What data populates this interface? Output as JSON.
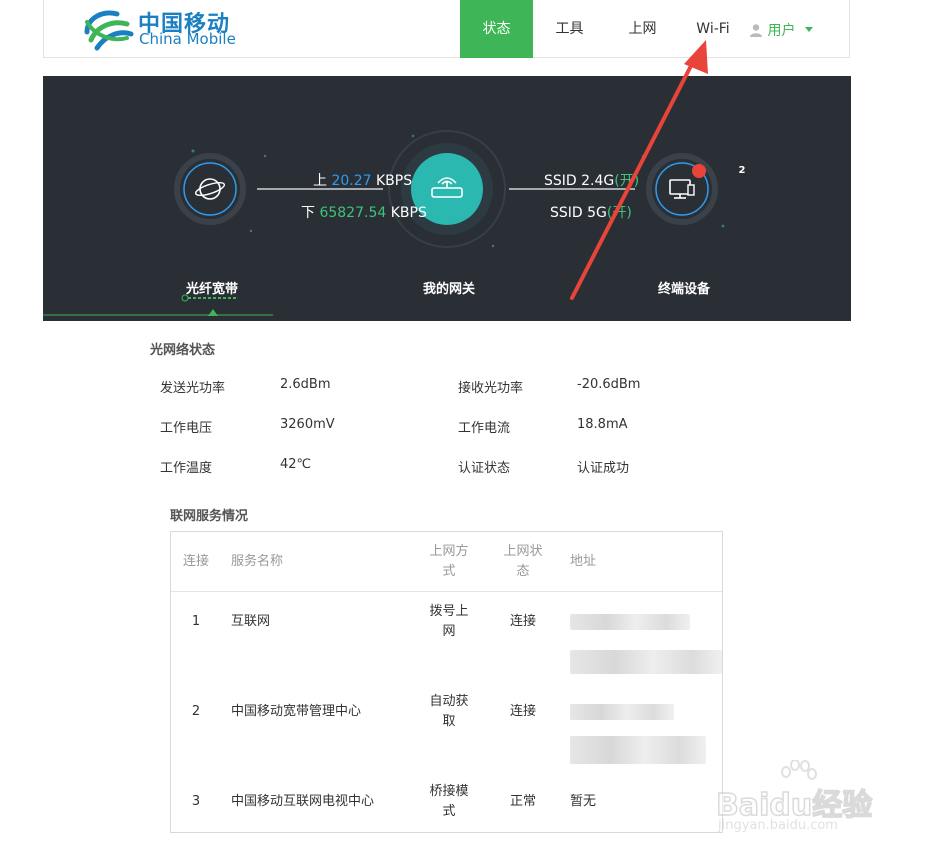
{
  "brand": {
    "name_cn": "中国移动",
    "name_en": "China Mobile"
  },
  "nav": {
    "items": [
      "状态",
      "工具",
      "上网",
      "Wi-Fi"
    ],
    "user_label": "用户"
  },
  "hero": {
    "upload_prefix": "上",
    "upload_value": "20.27",
    "upload_unit": "KBPS",
    "download_prefix": "下",
    "download_value": "65827.54",
    "download_unit": "KBPS",
    "ssid_24_label": "SSID 2.4G",
    "ssid_24_state": "(开)",
    "ssid_5_label": "SSID 5G",
    "ssid_5_state": "(开)",
    "device_count": "2",
    "labels": {
      "fiber": "光纤宽带",
      "gateway": "我的网关",
      "terminal": "终端设备"
    }
  },
  "optical": {
    "title": "光网络状态",
    "rows": [
      {
        "k1": "发送光功率",
        "v1": "2.6dBm",
        "k2": "接收光功率",
        "v2": "-20.6dBm"
      },
      {
        "k1": "工作电压",
        "v1": "3260mV",
        "k2": "工作电流",
        "v2": "18.8mA"
      },
      {
        "k1": "工作温度",
        "v1": "42℃",
        "k2": "认证状态",
        "v2": "认证成功"
      }
    ]
  },
  "service": {
    "title": "联网服务情况",
    "headers": {
      "conn": "连接",
      "name": "服务名称",
      "method_1": "上网方",
      "method_2": "式",
      "status_1": "上网状",
      "status_2": "态",
      "addr": "地址"
    },
    "rows": [
      {
        "idx": "1",
        "name": "互联网",
        "method_1": "拨号上",
        "method_2": "网",
        "status": "连接",
        "addr": ""
      },
      {
        "idx": "2",
        "name": "中国移动宽带管理中心",
        "method_1": "自动获",
        "method_2": "取",
        "status": "连接",
        "addr": ""
      },
      {
        "idx": "3",
        "name": "中国移动互联网电视中心",
        "method_1": "桥接模",
        "method_2": "式",
        "status": "正常",
        "addr": "暂无"
      }
    ]
  },
  "watermark": {
    "brand": "Bai",
    "brand2": "du",
    "suffix": "经验",
    "url": "jingyan.baidu.com"
  },
  "colors": {
    "accent": "#3eb556",
    "hero_bg": "#2a2f35",
    "upload": "#2d9cf0",
    "download": "#3ec47a",
    "arrow": "#e8443a"
  }
}
